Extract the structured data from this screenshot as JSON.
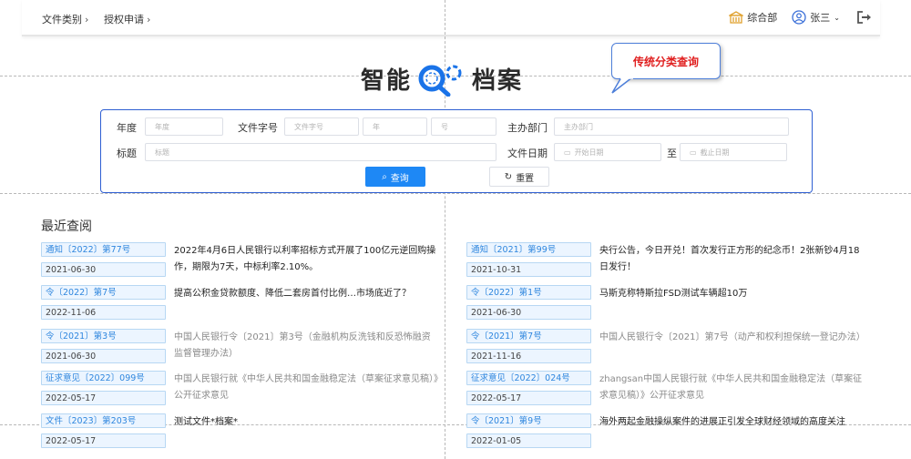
{
  "nav": {
    "breadcrumb1": "文件类别",
    "breadcrumb2": "授权申请",
    "department": "综合部",
    "user": "张三"
  },
  "logo": {
    "text_left": "智能",
    "text_right": "档案"
  },
  "callout": {
    "text": "传统分类查询"
  },
  "search": {
    "year_label": "年度",
    "year_placeholder": "年度",
    "docno_label": "文件字号",
    "docno_placeholder": "文件字号",
    "docno_year_placeholder": "年",
    "docno_num_placeholder": "号",
    "dept_label": "主办部门",
    "dept_placeholder": "主办部门",
    "title_label": "标题",
    "title_placeholder": "标题",
    "date_label": "文件日期",
    "start_placeholder": "开始日期",
    "to_text": "至",
    "end_placeholder": "截止日期",
    "query_label": "查询",
    "reset_label": "重置"
  },
  "recent": {
    "title": "最近查阅",
    "left": [
      {
        "tag": "通知〔2022〕第77号",
        "date": "2021-06-30",
        "desc": "2022年4月6日人民银行以利率招标方式开展了100亿元逆回购操作，期限为7天，中标利率2.10%。",
        "grey": false
      },
      {
        "tag": "令〔2022〕第7号",
        "date": "2022-11-06",
        "desc": "提高公积金贷款额度、降低二套房首付比例…市场底近了？",
        "grey": false
      },
      {
        "tag": "令〔2021〕第3号",
        "date": "2021-06-30",
        "desc": "中国人民银行令〔2021〕第3号（金融机构反洗钱和反恐怖融资监督管理办法）",
        "grey": true
      },
      {
        "tag": "征求意见〔2022〕099号",
        "date": "2022-05-17",
        "desc": "中国人民银行就《中华人民共和国金融稳定法（草案征求意见稿）》公开征求意见",
        "grey": true
      },
      {
        "tag": "文件〔2023〕第203号",
        "date": "2022-05-17",
        "desc": "测试文件*档案*",
        "grey": false
      }
    ],
    "right": [
      {
        "tag": "通知〔2021〕第99号",
        "date": "2021-10-31",
        "desc": "央行公告，今日开兑！首次发行正方形的纪念币！2张新钞4月18日发行！",
        "grey": false
      },
      {
        "tag": "令〔2022〕第1号",
        "date": "2021-06-30",
        "desc": "马斯克称特斯拉FSD测试车辆超10万",
        "grey": false
      },
      {
        "tag": "令〔2021〕第7号",
        "date": "2021-11-16",
        "desc": "中国人民银行令〔2021〕第7号（动产和权利担保统一登记办法）",
        "grey": true
      },
      {
        "tag": "征求意见〔2022〕024号",
        "date": "2022-05-17",
        "desc": "zhangsan中国人民银行就《中华人民共和国金融稳定法（草案征求意见稿）》公开征求意见",
        "grey": true
      },
      {
        "tag": "令〔2021〕第9号",
        "date": "2022-01-05",
        "desc": "海外两起金融操纵案件的进展正引发全球财经领域的高度关注",
        "grey": false
      }
    ]
  }
}
